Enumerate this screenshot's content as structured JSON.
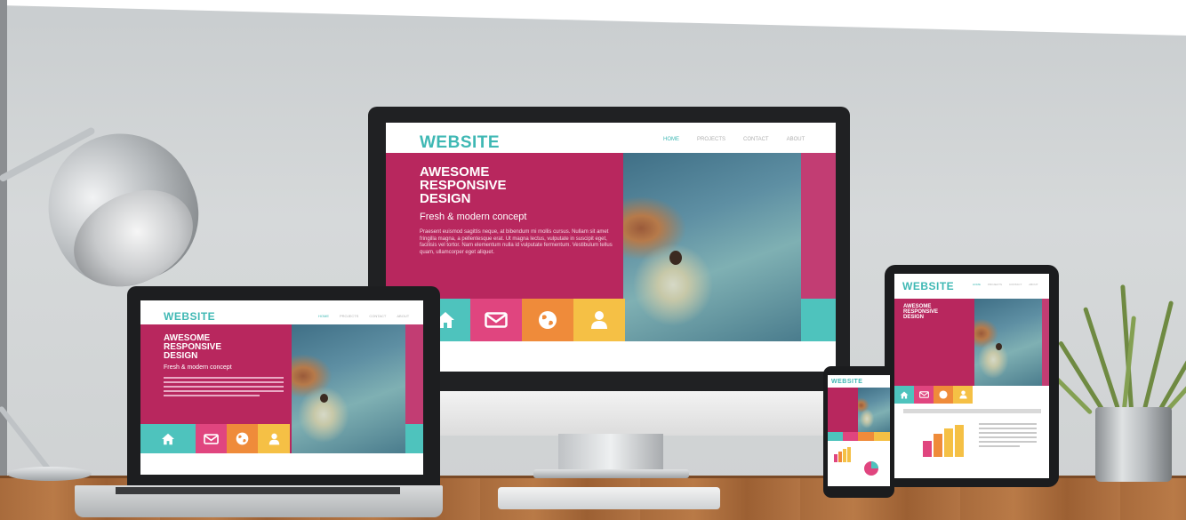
{
  "scene": {
    "monitor": {
      "logo": "WEBSITE",
      "nav": [
        "HOME",
        "PROJECTS",
        "CONTACT",
        "ABOUT"
      ],
      "hero_title": [
        "AWESOME",
        "RESPONSIVE",
        "DESIGN"
      ],
      "hero_subtitle": "Fresh & modern concept",
      "hero_body": "Praesent euismod sagittis neque, at bibendum mi mollis cursus. Nullam sit amet fringilla magna, a pellentesque erat. Ut magna lectus, vulputate in suscipit eget, facilisis vel tortor. Nam elementum nulla id vulputate fermentum. Vestibulum tellus quam, ullamcorper eget aliquet."
    },
    "laptop": {
      "logo": "WEBSITE",
      "hero_title": [
        "AWESOME",
        "RESPONSIVE",
        "DESIGN"
      ],
      "hero_subtitle": "Fresh & modern concept"
    },
    "tablet": {
      "logo": "WEBSITE"
    },
    "phone": {
      "logo": "WEBSITE"
    },
    "tile_icons": [
      "home-icon",
      "mail-icon",
      "globe-icon",
      "user-icon"
    ],
    "colors": {
      "magenta": "#b8275e",
      "teal": "#4ec3bd",
      "pink": "#e0457f",
      "orange": "#ef8b3a",
      "yellow": "#f5c045"
    }
  }
}
